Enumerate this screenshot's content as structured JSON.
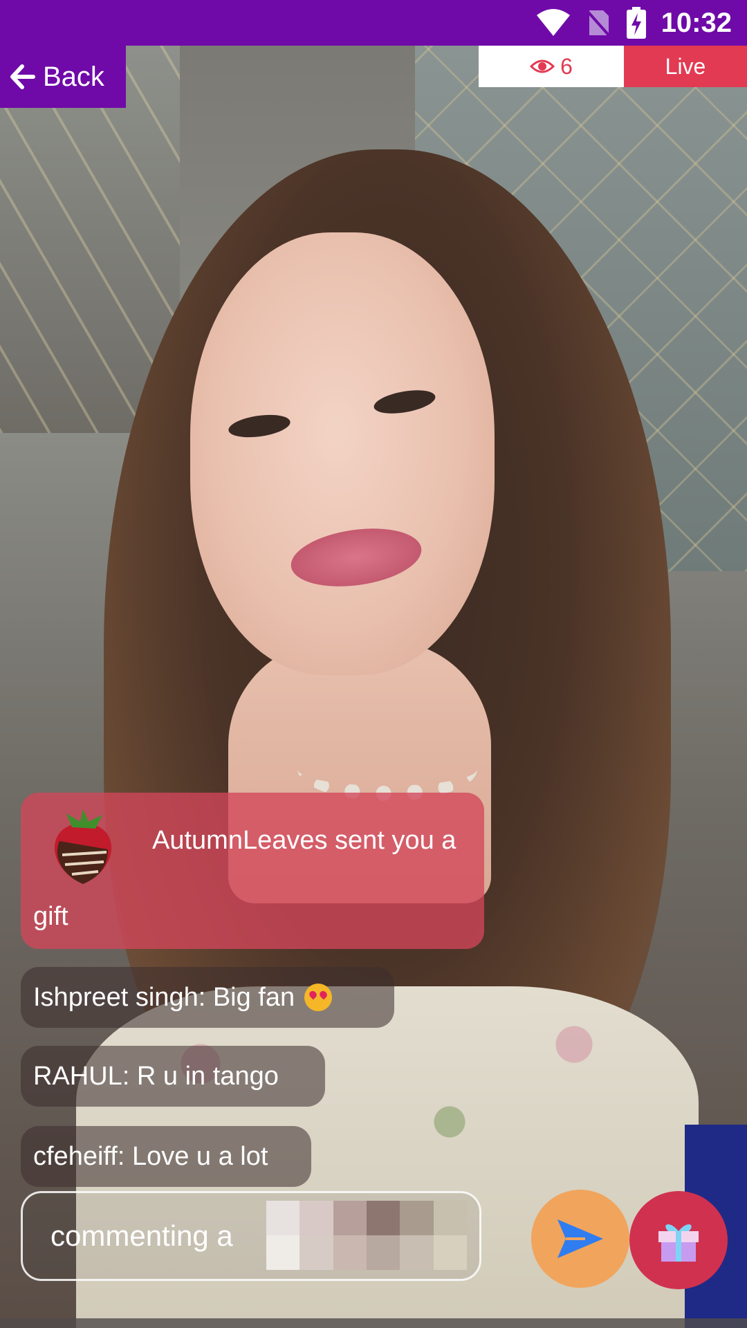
{
  "status_bar": {
    "time": "10:32",
    "icons": [
      "wifi-icon",
      "no-sim-icon",
      "battery-charging-icon"
    ]
  },
  "header": {
    "back_label": "Back",
    "viewer_count": "6",
    "live_label": "Live"
  },
  "chat": {
    "gift_banner": {
      "line1": "AutumnLeaves sent you a",
      "line2": "gift",
      "gift_icon": "chocolate-strawberry-icon"
    },
    "messages": [
      {
        "text": "Ishpreet singh: Big fan",
        "emoji": "heart-eyes-emoji"
      },
      {
        "text": "RAHUL: R u in tango"
      },
      {
        "text": "cfeheiff: Love u a lot"
      }
    ]
  },
  "comment": {
    "placeholder": "commenting a"
  },
  "actions": {
    "send_icon": "send-icon",
    "gift_icon": "gift-box-icon"
  },
  "colors": {
    "brand_purple": "#6f0aa8",
    "live_red": "#e23a52",
    "send_orange": "#f1a45c",
    "gift_red": "#d0314f"
  }
}
